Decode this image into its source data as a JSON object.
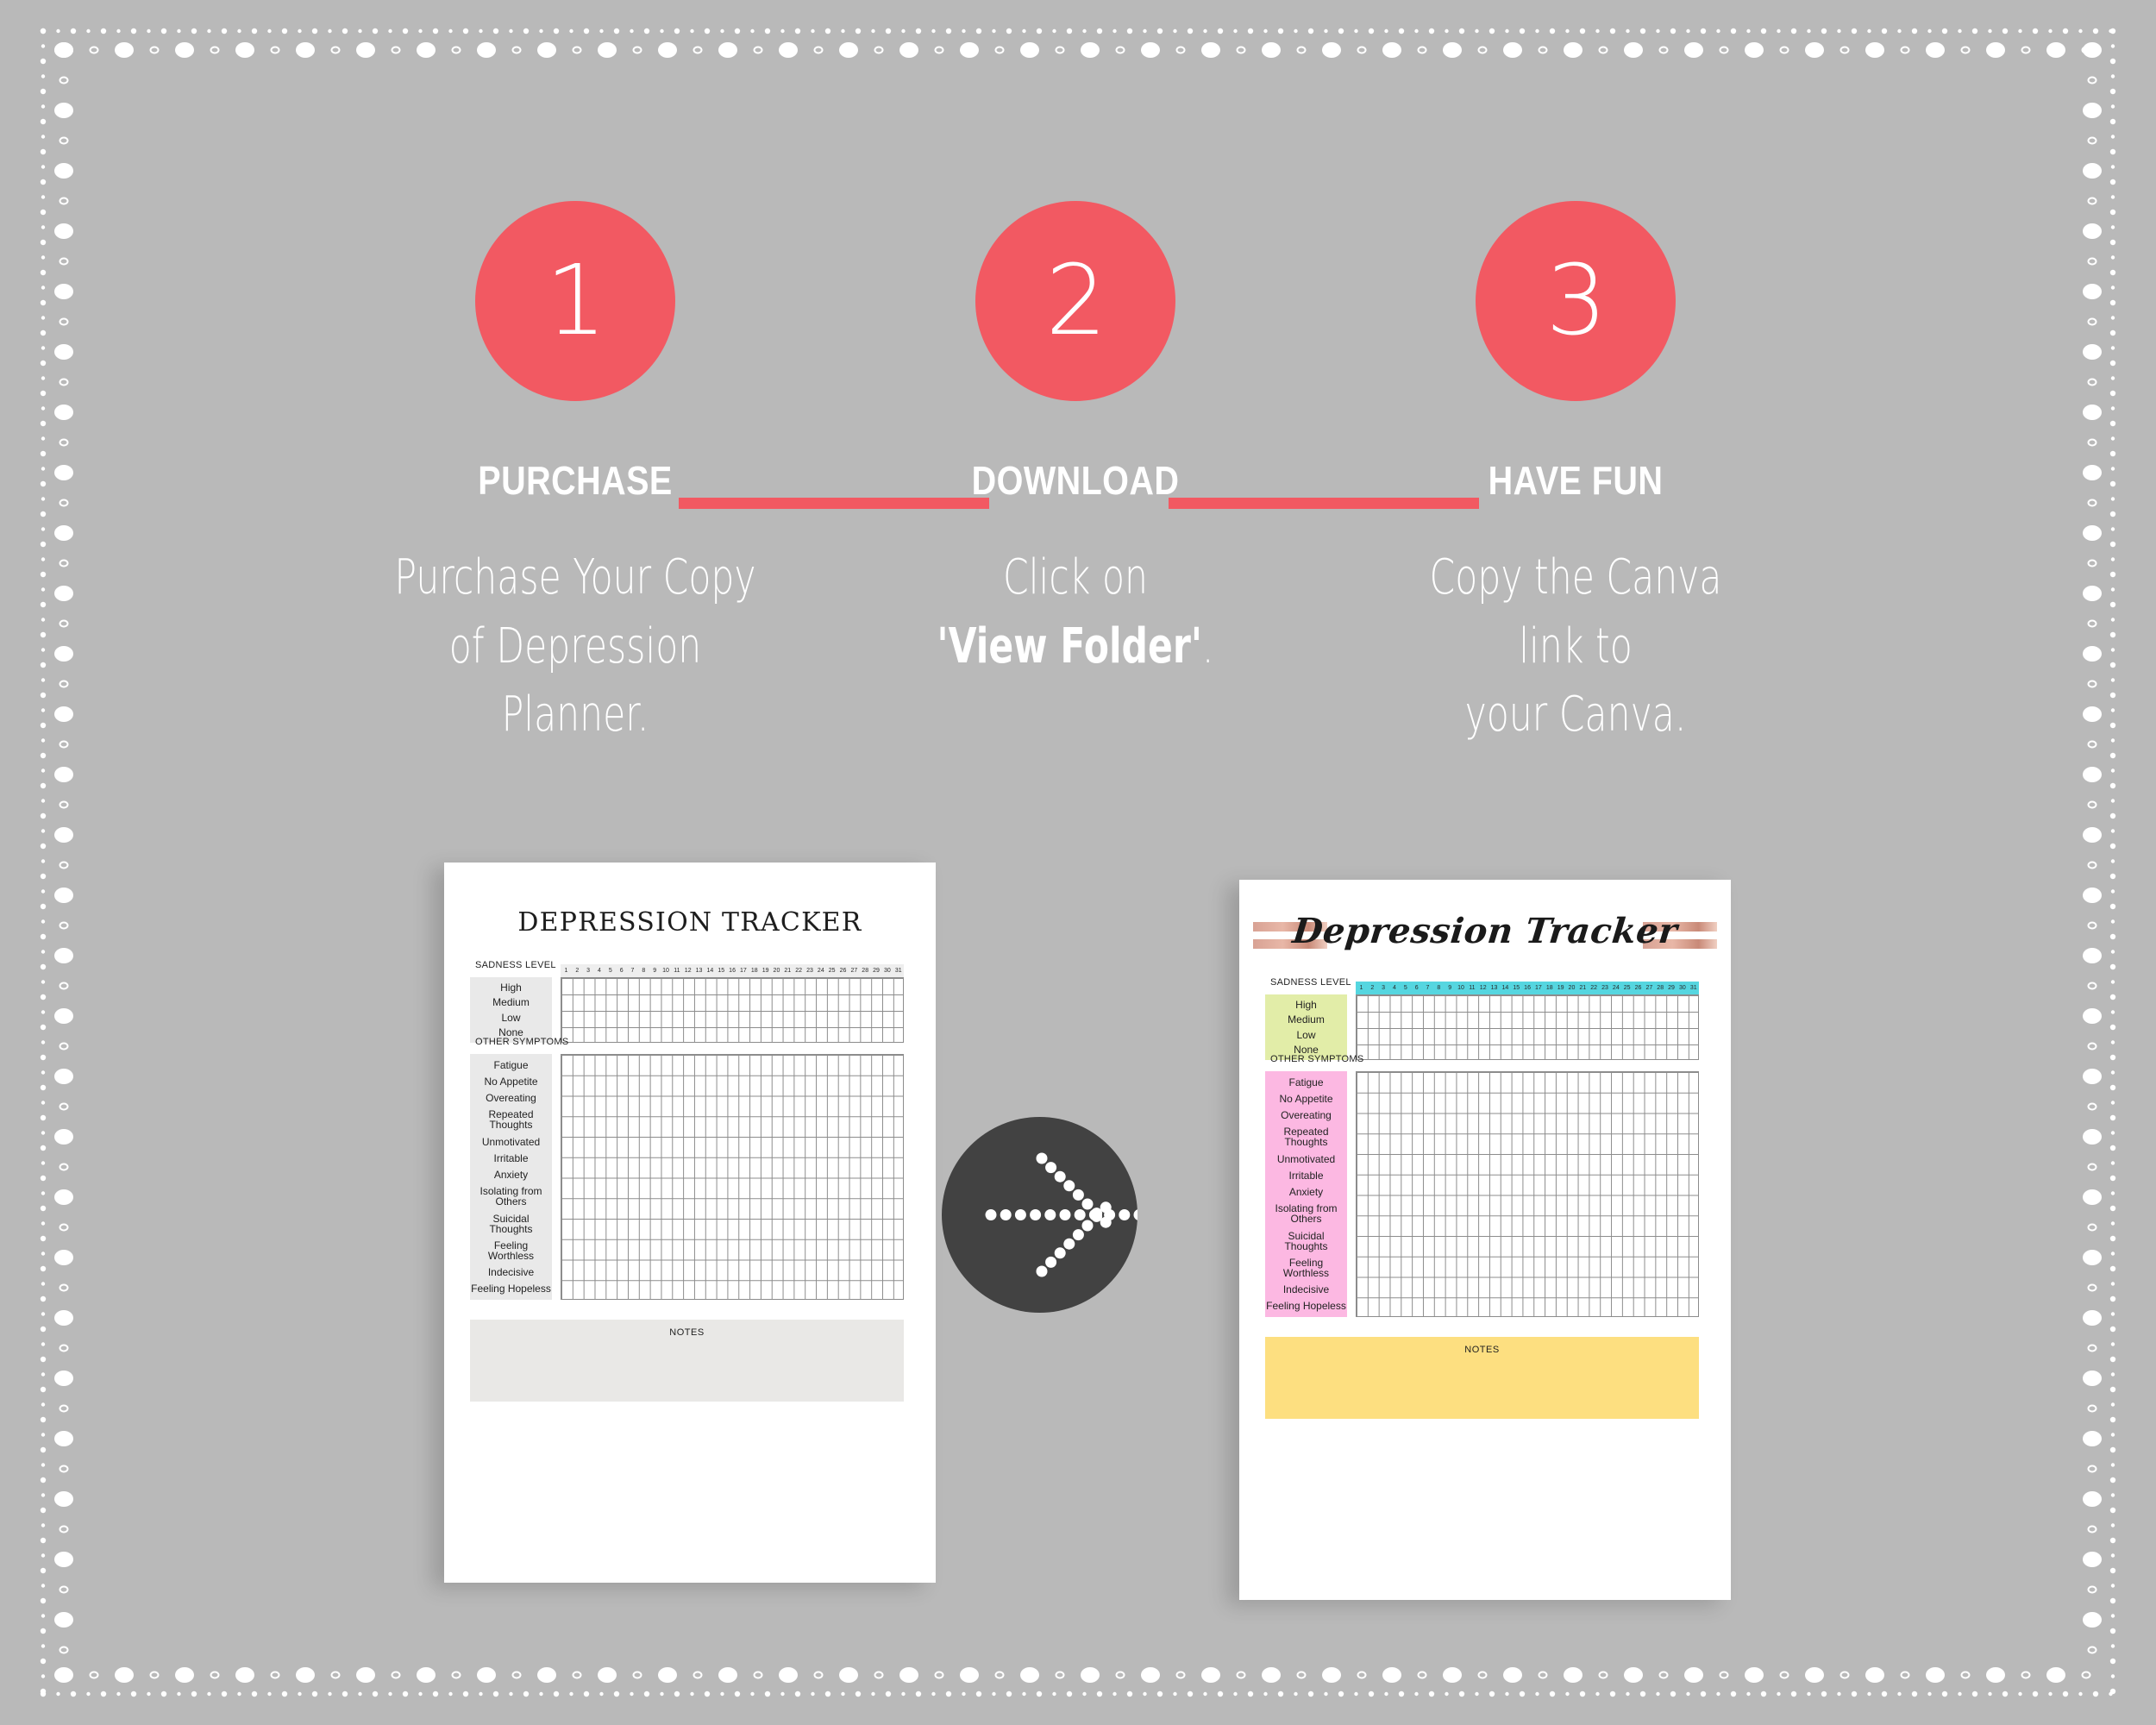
{
  "theme": {
    "background": "#b9b9b9",
    "accent_red": "#f25962",
    "text_white": "#ffffff",
    "badge_dark": "#424242",
    "panel_gray": "#e9e9e9",
    "panel_green": "#e2eda8",
    "panel_pink": "#fcb8e2",
    "header_cyan": "#55d6e0",
    "notes_yellow": "#fddf80",
    "rose_gold": "#d8a294"
  },
  "steps": [
    {
      "number": "1",
      "title": "PURCHASE",
      "desc_lines": [
        "Purchase Your Copy",
        "of Depression",
        "Planner."
      ]
    },
    {
      "number": "2",
      "title": "DOWNLOAD",
      "desc_prefix": "Click  on",
      "desc_bold": "'View Folder'",
      "desc_suffix": "."
    },
    {
      "number": "3",
      "title": "HAVE FUN",
      "desc_lines": [
        "Copy the Canva",
        "link to",
        "your Canva."
      ]
    }
  ],
  "arrow_badge": {
    "icon": "dotted-arrow-right-icon"
  },
  "tracker": {
    "title_plain": "DEPRESSION TRACKER",
    "title_script": "Depression Tracker",
    "sadness_label": "SADNESS LEVEL",
    "sadness_levels": [
      "High",
      "Medium",
      "Low",
      "None"
    ],
    "symptoms_label": "OTHER SYMPTOMS",
    "symptoms": [
      "Fatigue",
      "No Appetite",
      "Overeating",
      "Repeated Thoughts",
      "Unmotivated",
      "Irritable",
      "Anxiety",
      "Isolating from Others",
      "Suicidal Thoughts",
      "Feeling Worthless",
      "Indecisive",
      "Feeling Hopeless"
    ],
    "days": [
      "1",
      "2",
      "3",
      "4",
      "5",
      "6",
      "7",
      "8",
      "9",
      "10",
      "11",
      "12",
      "13",
      "14",
      "15",
      "16",
      "17",
      "18",
      "19",
      "20",
      "21",
      "22",
      "23",
      "24",
      "25",
      "26",
      "27",
      "28",
      "29",
      "30",
      "31"
    ],
    "notes_label": "NOTES"
  }
}
